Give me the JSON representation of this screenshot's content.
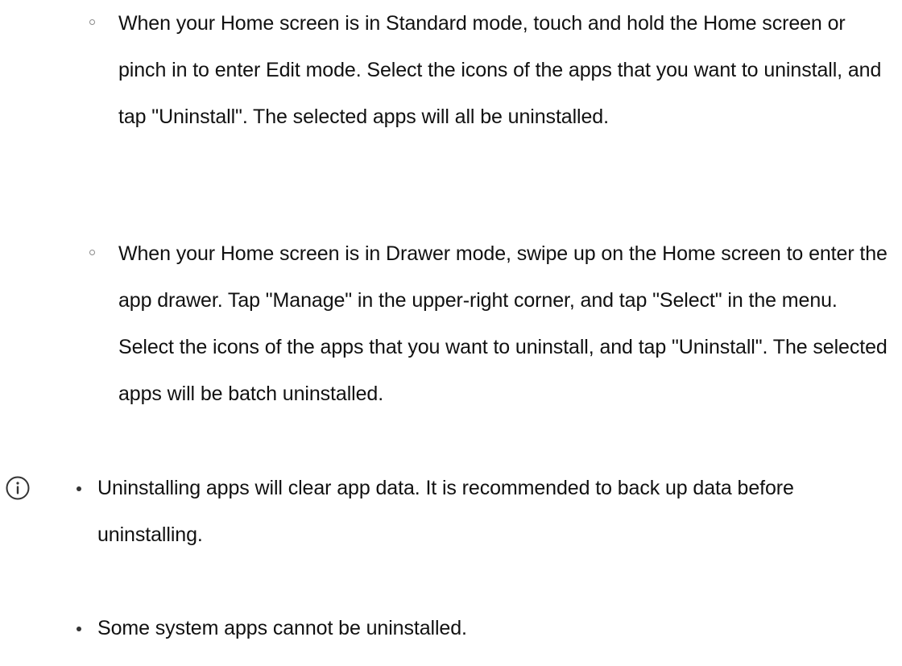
{
  "steps": [
    {
      "text": "When your Home screen is in Standard mode, touch and hold the Home screen or pinch in to enter Edit mode. Select the icons of the apps that you want to uninstall, and tap \"Uninstall\". The selected apps will all be uninstalled."
    },
    {
      "text": "When your Home screen is in Drawer mode, swipe up on the Home screen to enter the app drawer. Tap \"Manage\" in the upper-right corner, and tap \"Select\" in the menu. Select the icons of the apps that you want to uninstall, and tap \"Uninstall\". The selected apps will be batch uninstalled."
    }
  ],
  "note": {
    "icon": "info-icon",
    "items": [
      "Uninstalling apps will clear app data. It is recommended to back up data before uninstalling.",
      "Some system apps cannot be uninstalled."
    ]
  },
  "colors": {
    "text": "#111111",
    "icon": "#333333"
  }
}
